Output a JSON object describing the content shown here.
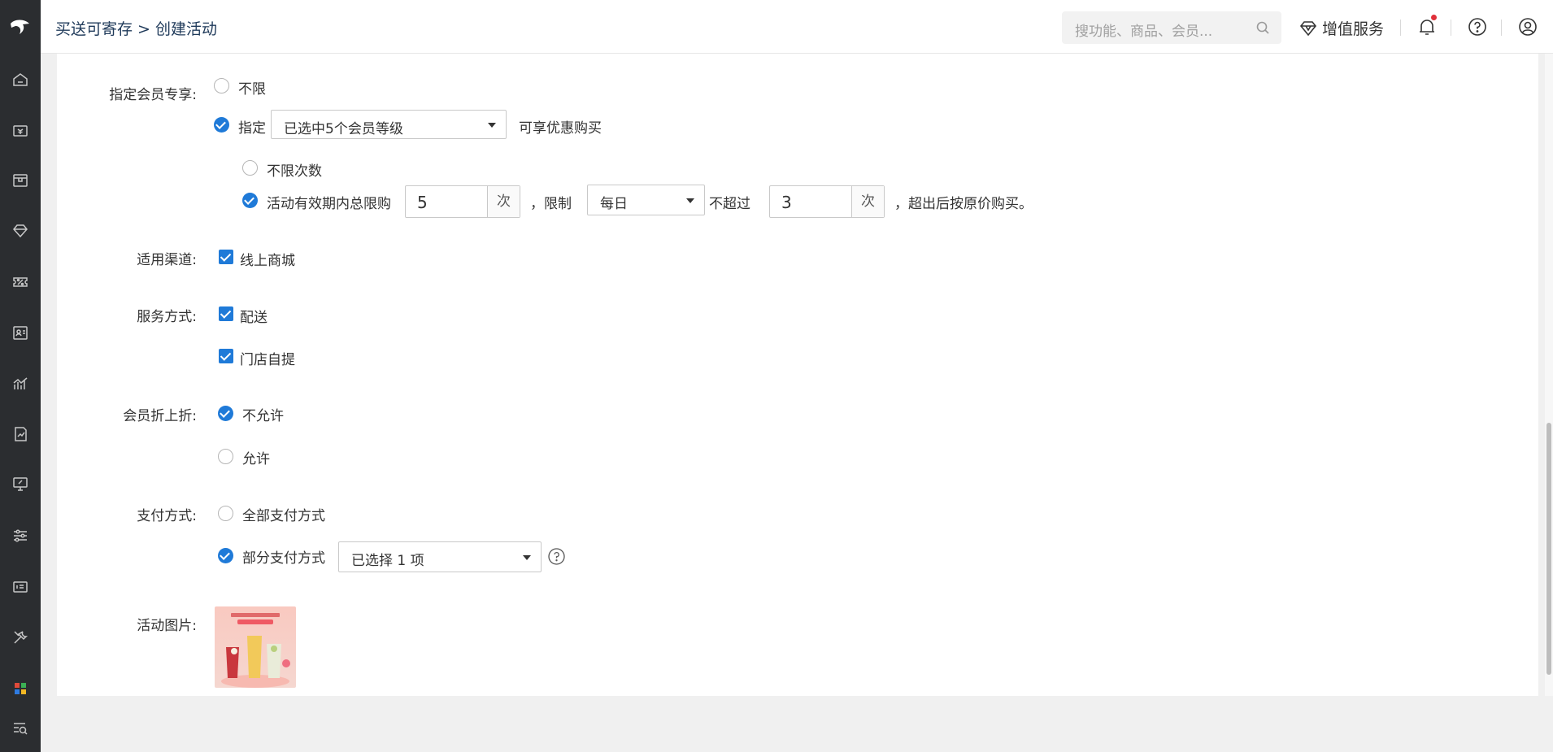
{
  "header": {
    "breadcrumb": "买送可寄存 > 创建活动",
    "search_placeholder": "搜功能、商品、会员...",
    "value_added_service": "增值服务"
  },
  "sidebar": {
    "icons": [
      "logo-icon",
      "home-icon",
      "cashier-icon",
      "box-icon",
      "diamond-icon",
      "coupon-icon",
      "member-card-icon",
      "chart-icon",
      "report-icon",
      "monitor-icon",
      "sliders-icon",
      "ticket-icon",
      "tools-icon",
      "apps-icon",
      "search-list-icon"
    ]
  },
  "form": {
    "member_exclusive": {
      "label": "指定会员专享:",
      "opt_unlimited": "不限",
      "opt_specify": "指定",
      "selected_levels": "已选中5个会员等级",
      "suffix": "可享优惠购买"
    },
    "limits": {
      "opt_unlimited_times": "不限次数",
      "opt_total_limit": "活动有效期内总限购",
      "total_value": "5",
      "unit_times": "次",
      "comma_limit": "，限制",
      "period": "每日",
      "not_exceed": "不超过",
      "per_period_value": "3",
      "tail": "，超出后按原价购买。"
    },
    "channel": {
      "label": "适用渠道:",
      "online_mall": "线上商城"
    },
    "service": {
      "label": "服务方式:",
      "delivery": "配送",
      "pickup": "门店自提"
    },
    "member_discount": {
      "label": "会员折上折:",
      "not_allowed": "不允许",
      "allowed": "允许"
    },
    "payment": {
      "label": "支付方式:",
      "all": "全部支付方式",
      "partial": "部分支付方式",
      "selected": "已选择 1 项"
    },
    "image": {
      "label": "活动图片:"
    }
  },
  "colors": {
    "accent": "#1f7ad8",
    "sidebar": "#2b2d30",
    "bell_dot": "#e0303a"
  }
}
